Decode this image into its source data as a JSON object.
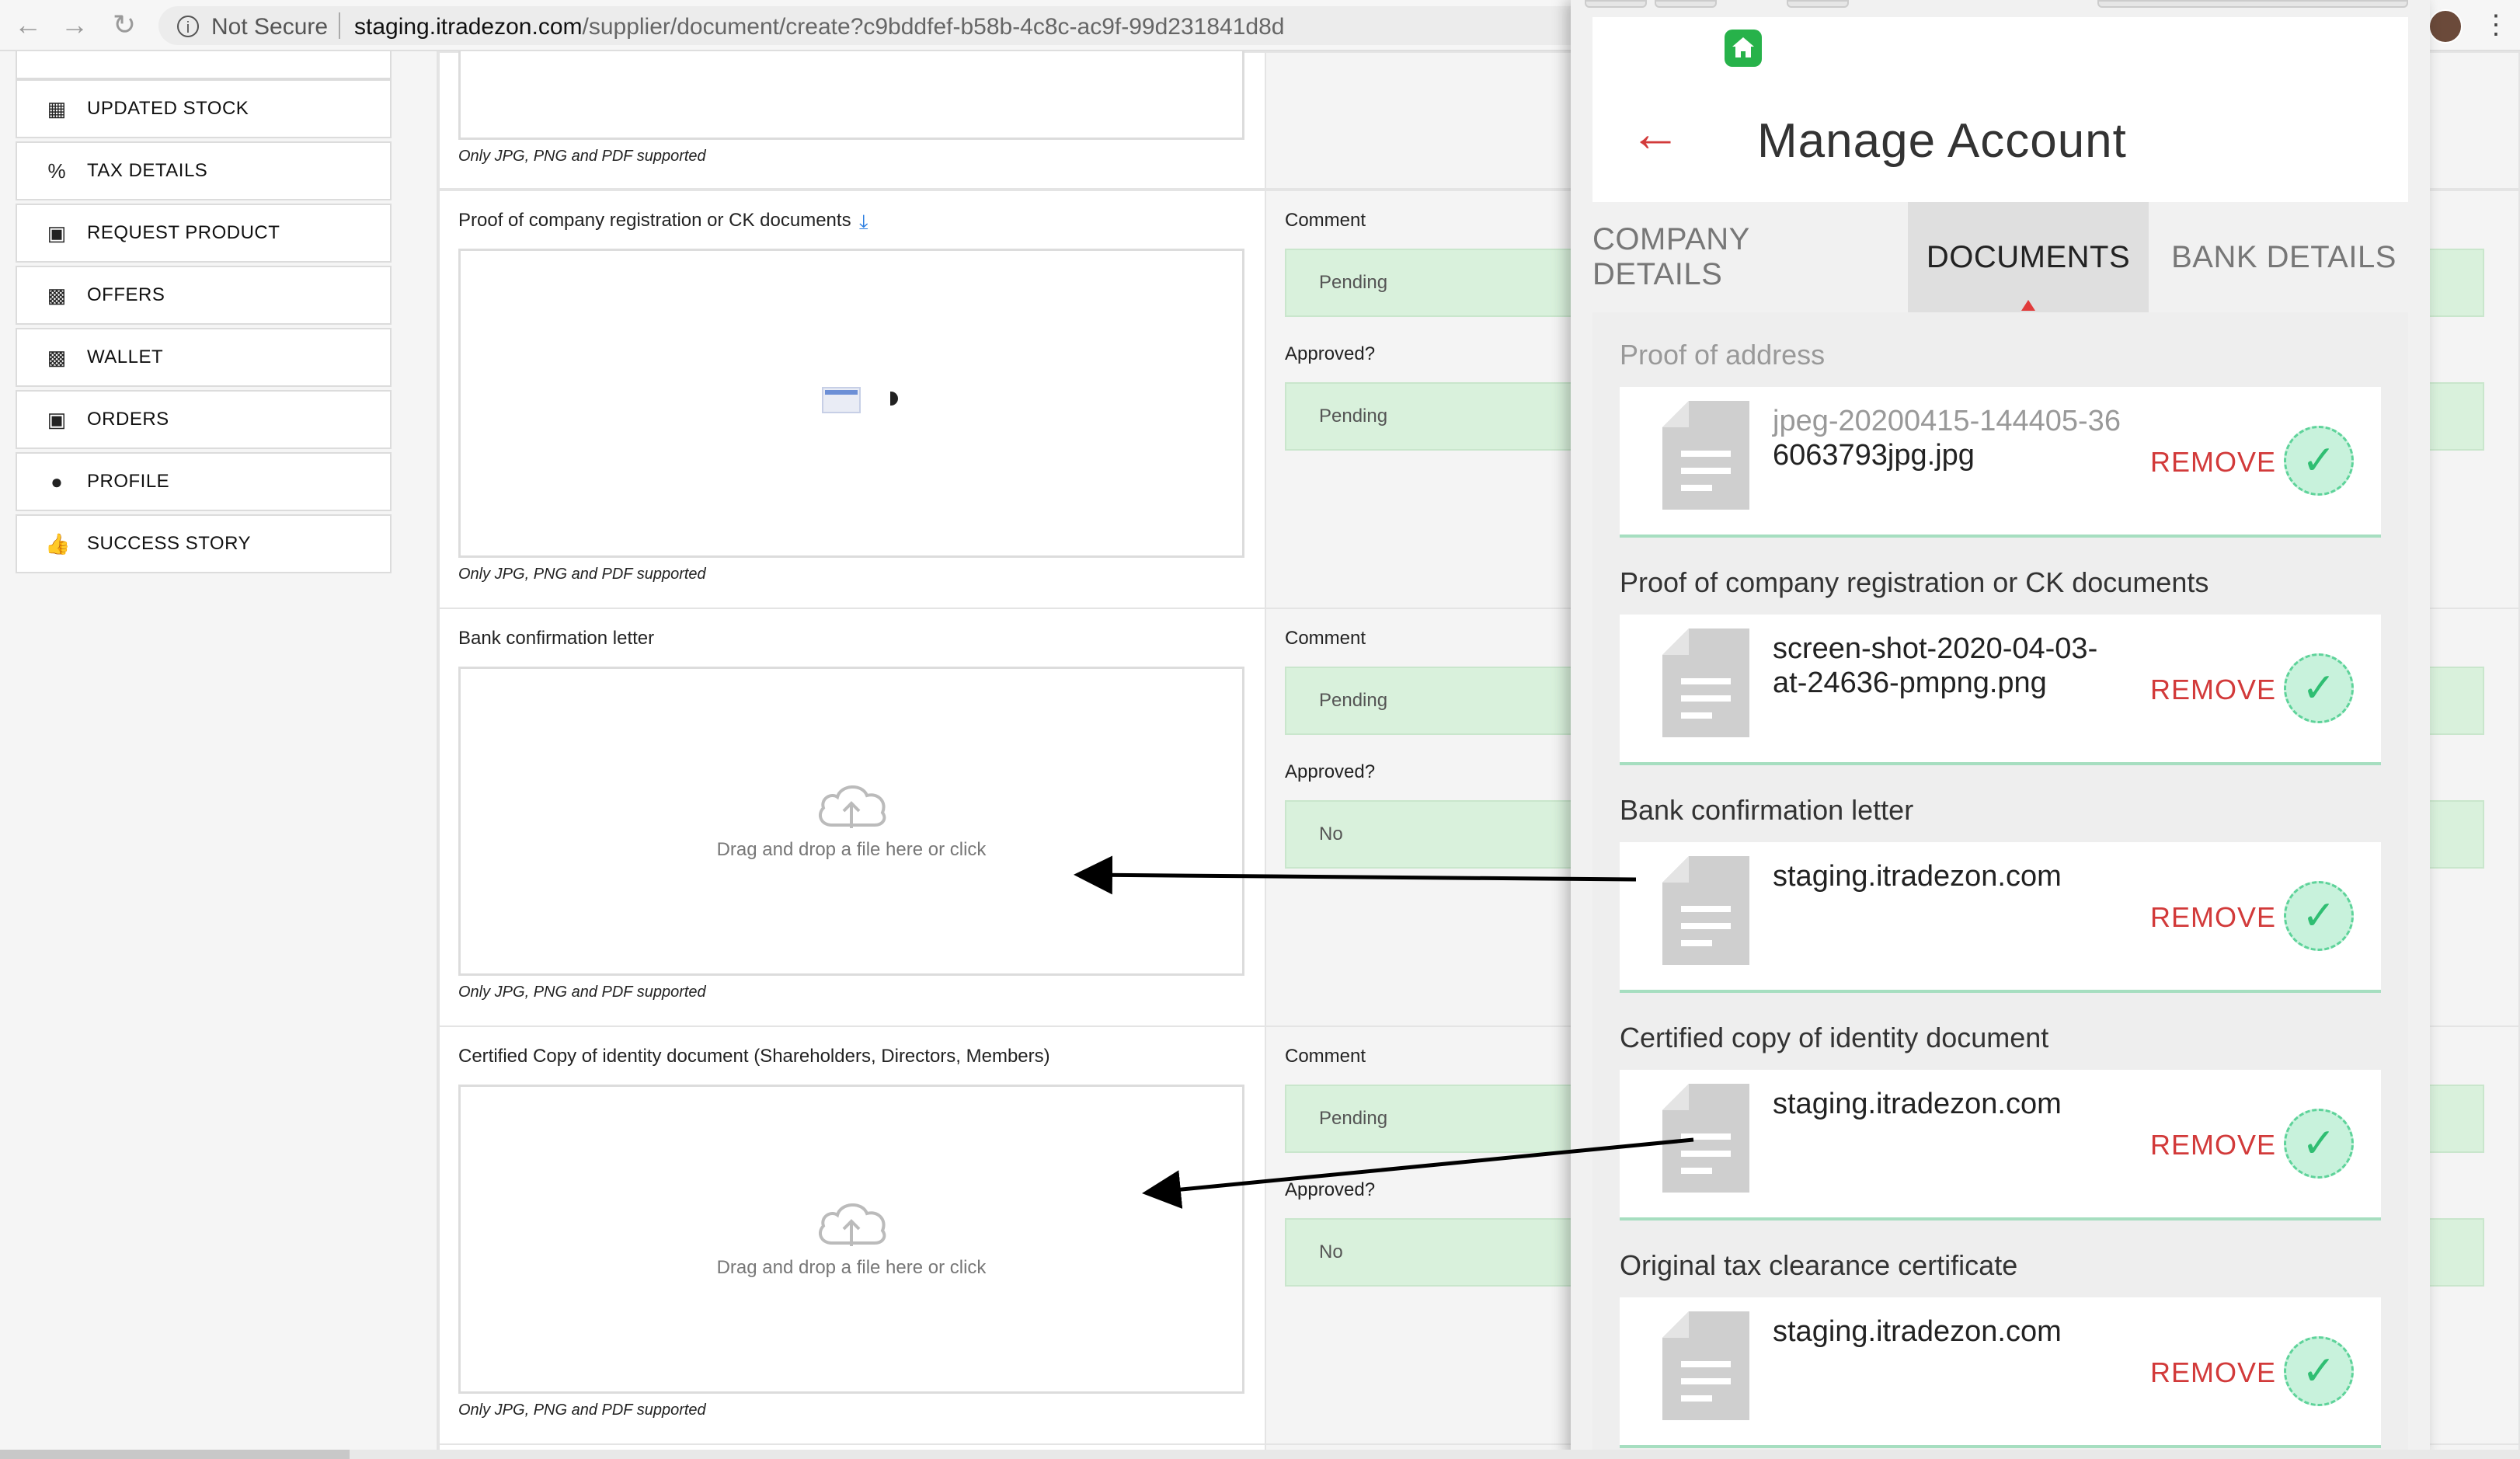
{
  "browser": {
    "security": "Not Secure",
    "url_domain": "staging.itradezon.com",
    "url_path": "/supplier/document/create?c9bddfef-b58b-4c8c-ac9f-99d231841d8d"
  },
  "sidebar": {
    "items": [
      {
        "label": "UPDATED STOCK",
        "icon": "table-icon"
      },
      {
        "label": "TAX DETAILS",
        "icon": "percent-icon"
      },
      {
        "label": "REQUEST PRODUCT",
        "icon": "boxes-icon"
      },
      {
        "label": "OFFERS",
        "icon": "wallet-icon"
      },
      {
        "label": "WALLET",
        "icon": "wallet-icon"
      },
      {
        "label": "ORDERS",
        "icon": "boxes-icon"
      },
      {
        "label": "PROFILE",
        "icon": "user-icon"
      },
      {
        "label": "SUCCESS STORY",
        "icon": "thumbs-up-icon"
      }
    ]
  },
  "documents": {
    "hint": "Only JPG, PNG and PDF supported",
    "comment_label": "Comment",
    "approved_label": "Approved?",
    "drag_text": "Drag and drop a file here or click",
    "rows": [
      {
        "title": "Proof of company registration or CK documents",
        "comment": "Pending",
        "approved": "Pending"
      },
      {
        "title": "Bank confirmation letter",
        "comment": "Pending",
        "approved": "No"
      },
      {
        "title": "Certified Copy of identity document (Shareholders, Directors, Members)",
        "comment": "Pending",
        "approved": "No"
      }
    ]
  },
  "phone": {
    "title": "Manage Account",
    "tabs": [
      "COMPANY DETAILS",
      "DOCUMENTS",
      "BANK DETAILS"
    ],
    "active_tab": "DOCUMENTS",
    "remove_label": "REMOVE",
    "sections": [
      {
        "label": "Proof of address",
        "file_line1": "jpeg-20200415-144405-36",
        "file_line2": "6063793jpg.jpg"
      },
      {
        "label": "Proof of company registration or CK documents",
        "file_line1": "screen-shot-2020-04-03-",
        "file_line2": "at-24636-pmpng.png"
      },
      {
        "label": "Bank confirmation letter",
        "file_line1": "staging.itradezon.com",
        "file_line2": ""
      },
      {
        "label": "Certified copy of identity document",
        "file_line1": "staging.itradezon.com",
        "file_line2": ""
      },
      {
        "label": "Original tax clearance certificate",
        "file_line1": "staging.itradezon.com",
        "file_line2": ""
      }
    ]
  },
  "colors": {
    "status_green": "#d9f1dc",
    "remove_red": "#d23a3a",
    "check_green": "#2fbe72",
    "home_green": "#27b24a"
  }
}
